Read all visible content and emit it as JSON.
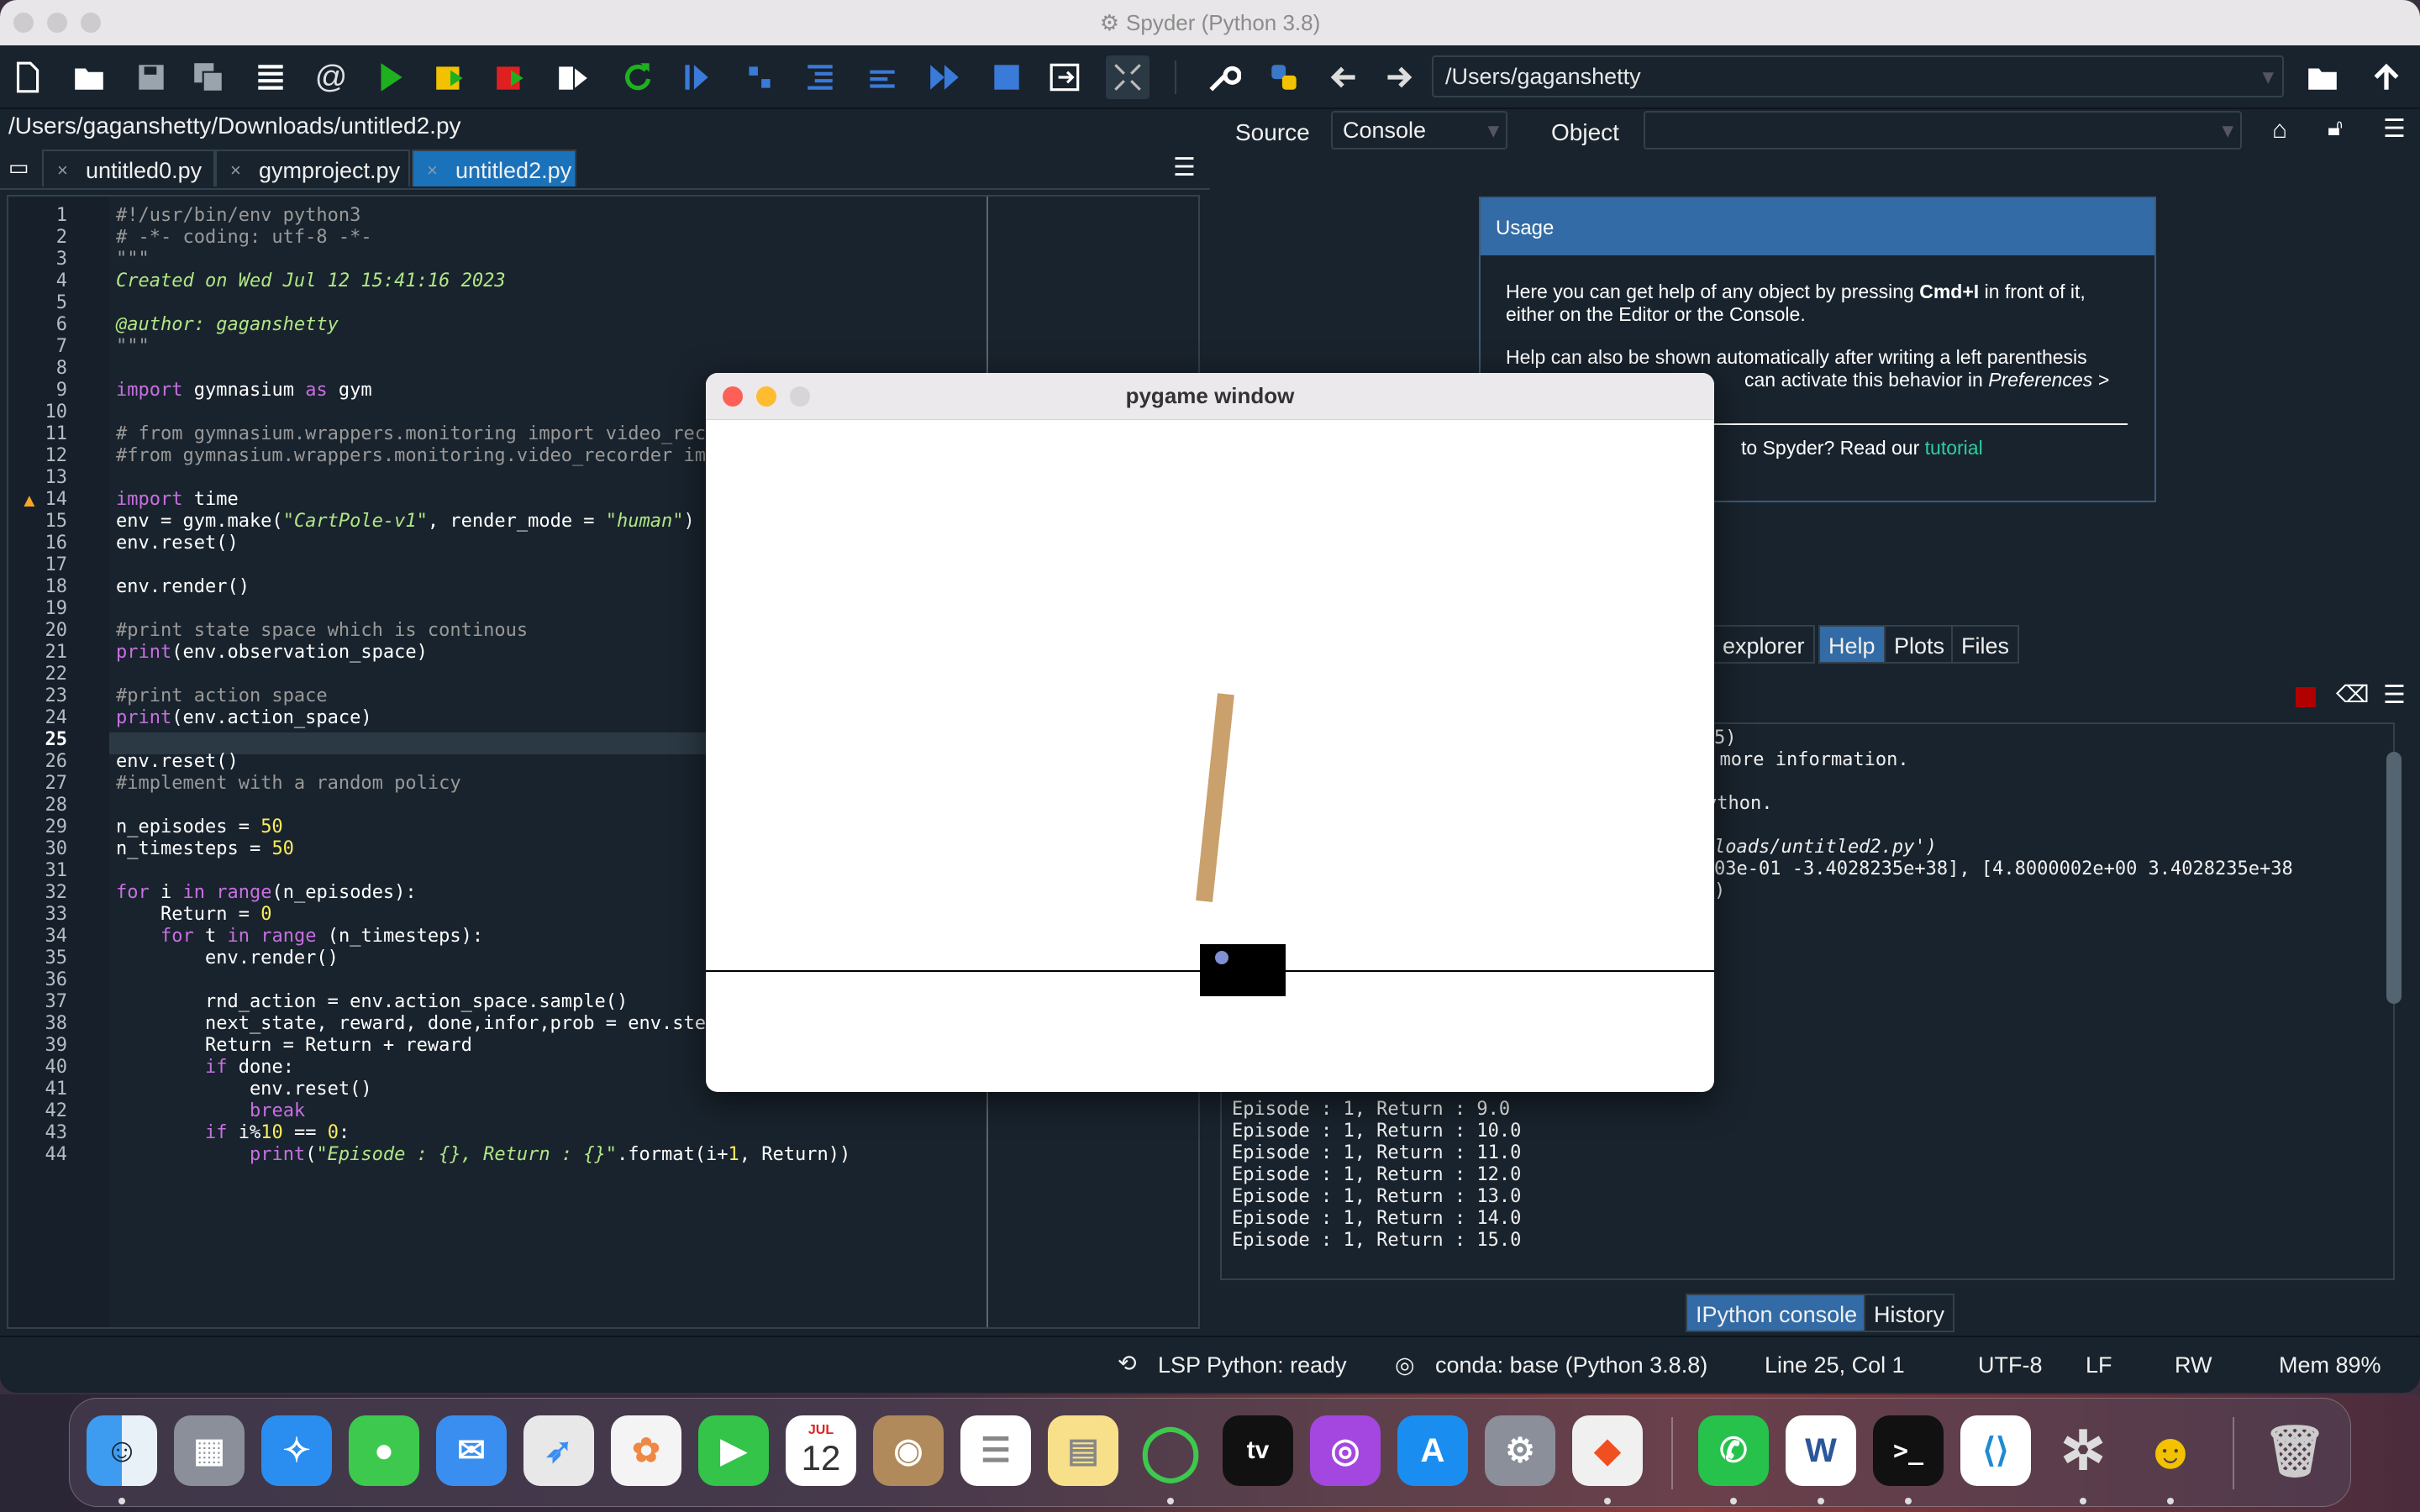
{
  "window": {
    "title": "Spyder (Python 3.8)"
  },
  "toolbar": {
    "path": "/Users/gaganshetty"
  },
  "editor": {
    "file_path": "/Users/gaganshetty/Downloads/untitled2.py",
    "tabs": [
      "untitled0.py",
      "gymproject.py",
      "untitled2.py"
    ],
    "active_tab": "untitled2.py"
  },
  "help": {
    "source_label": "Source",
    "source_value": "Console",
    "object_label": "Object",
    "usage_title": "Usage",
    "usage_p1_a": "Here you can get help of any object by pressing ",
    "usage_p1_key": "Cmd+I",
    "usage_p1_b": " in front of it,",
    "usage_p1_c": "either on the Editor or the Console.",
    "usage_p2_a": "Help can also be shown automatically after writing a left parenthesis",
    "usage_p2_b": "can activate this behavior in ",
    "usage_p2_c": "Preferences >",
    "usage_p3_a": "to Spyder? Read our ",
    "usage_p3_link": "tutorial"
  },
  "pane_tabs": [
    "explorer",
    "Help",
    "Plots",
    "Files"
  ],
  "console_tabs": [
    "IPython console",
    "History"
  ],
  "console_lines_top": [
    "5)",
    "r more information.",
    "ython.",
    "loads/untitled2.py')",
    "03e-01 -3.4028235e+38], [4.8000002e+00 3.4028235e+38",
    ")"
  ],
  "console_lines_bottom": [
    "Episode : 1, Return : 9.0",
    "Episode : 1, Return : 10.0",
    "Episode : 1, Return : 11.0",
    "Episode : 1, Return : 12.0",
    "Episode : 1, Return : 13.0",
    "Episode : 1, Return : 14.0",
    "Episode : 1, Return : 15.0"
  ],
  "pygame": {
    "title": "pygame window"
  },
  "status": {
    "lsp": "LSP Python: ready",
    "conda": "conda: base (Python 3.8.8)",
    "position": "Line 25, Col 1",
    "encoding": "UTF-8",
    "eol": "LF",
    "mode": "RW",
    "mem": "Mem 89%"
  },
  "dock": {
    "calendar_month": "JUL",
    "calendar_day": "12",
    "tv_label": "tv"
  },
  "code": {
    "l1": "#!/usr/bin/env python3",
    "l2": "# -*- coding: utf-8 -*-",
    "l3": "\"\"\"",
    "l4": "Created on Wed Jul 12 15:41:16 2023",
    "l6": "@author: gaganshetty",
    "l7": "\"\"\"",
    "l9a": "import",
    "l9b": " gymnasium ",
    "l9c": "as",
    "l9d": " gym",
    "l11": "# from gymnasium.wrappers.monitoring import video_rec",
    "l12": "#from gymnasium.wrappers.monitoring.video_recorder im",
    "l14a": "import",
    "l14b": " time",
    "l15a": "env = gym.make(",
    "l15b": "\"CartPole-v1\"",
    "l15c": ", render_mode = ",
    "l15d": "\"human\"",
    "l15e": ")",
    "l16": "env.reset()",
    "l18": "env.render()",
    "l20": "#print state space which is continous",
    "l21a": "print",
    "l21b": "(env.observation_space)",
    "l23": "#print action space",
    "l24a": "print",
    "l24b": "(env.action_space)",
    "l26": "env.reset()",
    "l27": "#implement with a random policy",
    "l29a": "n_episodes = ",
    "l29b": "50",
    "l30a": "n_timesteps = ",
    "l30b": "50",
    "l32a": "for",
    "l32b": " i ",
    "l32c": "in",
    "l32d": " ",
    "l32e": "range",
    "l32f": "(n_episodes):",
    "l33a": "    Return = ",
    "l33b": "0",
    "l34a": "    ",
    "l34b": "for",
    "l34c": " t ",
    "l34d": "in",
    "l34e": " ",
    "l34f": "range",
    "l34g": " (n_timesteps):",
    "l35": "        env.render()",
    "l37": "        rnd_action = env.action_space.sample()",
    "l38": "        next_state, reward, done,infor,prob = env.ste",
    "l39": "        Return = Return + reward",
    "l40a": "        ",
    "l40b": "if",
    "l40c": " done:",
    "l41": "            env.reset()",
    "l42a": "            ",
    "l42b": "break",
    "l43a": "        ",
    "l43b": "if",
    "l43c": " i%",
    "l43d": "10",
    "l43e": " == ",
    "l43f": "0",
    "l43g": ":",
    "l44a": "            ",
    "l44b": "print",
    "l44c": "(",
    "l44d": "\"Episode : {}, Return : {}\"",
    "l44e": ".format(i+",
    "l44f": "1",
    "l44g": ", Return))"
  },
  "line_numbers": [
    "1",
    "2",
    "3",
    "4",
    "5",
    "6",
    "7",
    "8",
    "9",
    "10",
    "11",
    "12",
    "13",
    "14",
    "15",
    "16",
    "17",
    "18",
    "19",
    "20",
    "21",
    "22",
    "23",
    "24",
    "25",
    "26",
    "27",
    "28",
    "29",
    "30",
    "31",
    "32",
    "33",
    "34",
    "35",
    "36",
    "37",
    "38",
    "39",
    "40",
    "41",
    "42",
    "43",
    "44"
  ]
}
